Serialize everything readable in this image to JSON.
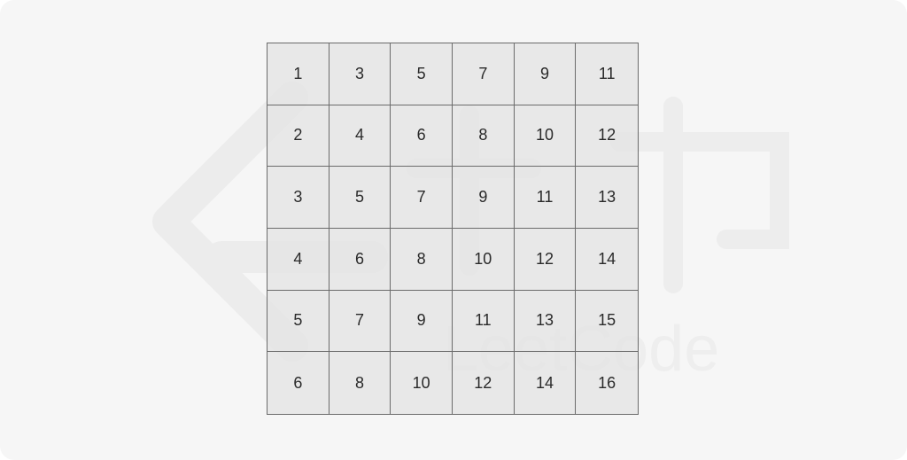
{
  "grid": {
    "rows": [
      [
        "1",
        "3",
        "5",
        "7",
        "9",
        "11"
      ],
      [
        "2",
        "4",
        "6",
        "8",
        "10",
        "12"
      ],
      [
        "3",
        "5",
        "7",
        "9",
        "11",
        "13"
      ],
      [
        "4",
        "6",
        "8",
        "10",
        "12",
        "14"
      ],
      [
        "5",
        "7",
        "9",
        "11",
        "13",
        "15"
      ],
      [
        "6",
        "8",
        "10",
        "12",
        "14",
        "16"
      ]
    ]
  },
  "watermark": {
    "text": "LeetCode"
  },
  "colors": {
    "background": "#f6f6f6",
    "cell_fill": "#e4e4e4",
    "grid_line": "#6b6b6b",
    "text": "#2a2a2a"
  }
}
